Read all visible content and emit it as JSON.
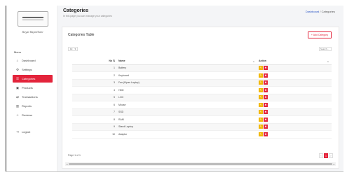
{
  "sidebar": {
    "logo_text": "INSTA HOUSING",
    "logo_subtitle": "Royal Rajasthani",
    "menu_title": "Menu",
    "items": [
      {
        "label": "Dashboard",
        "icon": "home-icon",
        "glyph": "⌂"
      },
      {
        "label": "Settings",
        "icon": "gear-icon",
        "glyph": "⚙"
      },
      {
        "label": "Categories",
        "icon": "list-icon",
        "glyph": "☰"
      },
      {
        "label": "Products",
        "icon": "bag-icon",
        "glyph": "▣"
      },
      {
        "label": "Transactions",
        "icon": "transactions-icon",
        "glyph": "⇄"
      },
      {
        "label": "Reports",
        "icon": "chart-icon",
        "glyph": "▥"
      },
      {
        "label": "Reviews",
        "icon": "star-icon",
        "glyph": "☆"
      },
      {
        "label": "Logout",
        "icon": "logout-icon",
        "glyph": "⇥"
      }
    ],
    "active_index": 2
  },
  "header": {
    "title": "Categories",
    "subtitle": "In this page you can manage your categories",
    "breadcrumb": {
      "link": "Dashboard",
      "separator": "/",
      "current": "Categories"
    }
  },
  "card": {
    "title": "Categories Table",
    "add_button": "+ Add Category",
    "page_length": "10",
    "search_placeholder": "Search..."
  },
  "table": {
    "columns": {
      "no": "No",
      "name": "Name",
      "action": "Action"
    },
    "rows": [
      {
        "no": "1",
        "name": "Battery"
      },
      {
        "no": "2",
        "name": "Keyboard"
      },
      {
        "no": "3",
        "name": "Fan (Kipas Laptop)"
      },
      {
        "no": "4",
        "name": "HDD"
      },
      {
        "no": "5",
        "name": "LCD"
      },
      {
        "no": "6",
        "name": "Mouse"
      },
      {
        "no": "7",
        "name": "SSD"
      },
      {
        "no": "8",
        "name": "RAM"
      },
      {
        "no": "9",
        "name": "Stand Laptop"
      },
      {
        "no": "10",
        "name": "Adaptor"
      }
    ]
  },
  "pagination": {
    "info": "Page 1 of 1",
    "prev": "‹",
    "current": "1",
    "next": "›"
  },
  "colors": {
    "accent": "#e3243b",
    "edit": "#f2b705",
    "link": "#2a55c4"
  }
}
